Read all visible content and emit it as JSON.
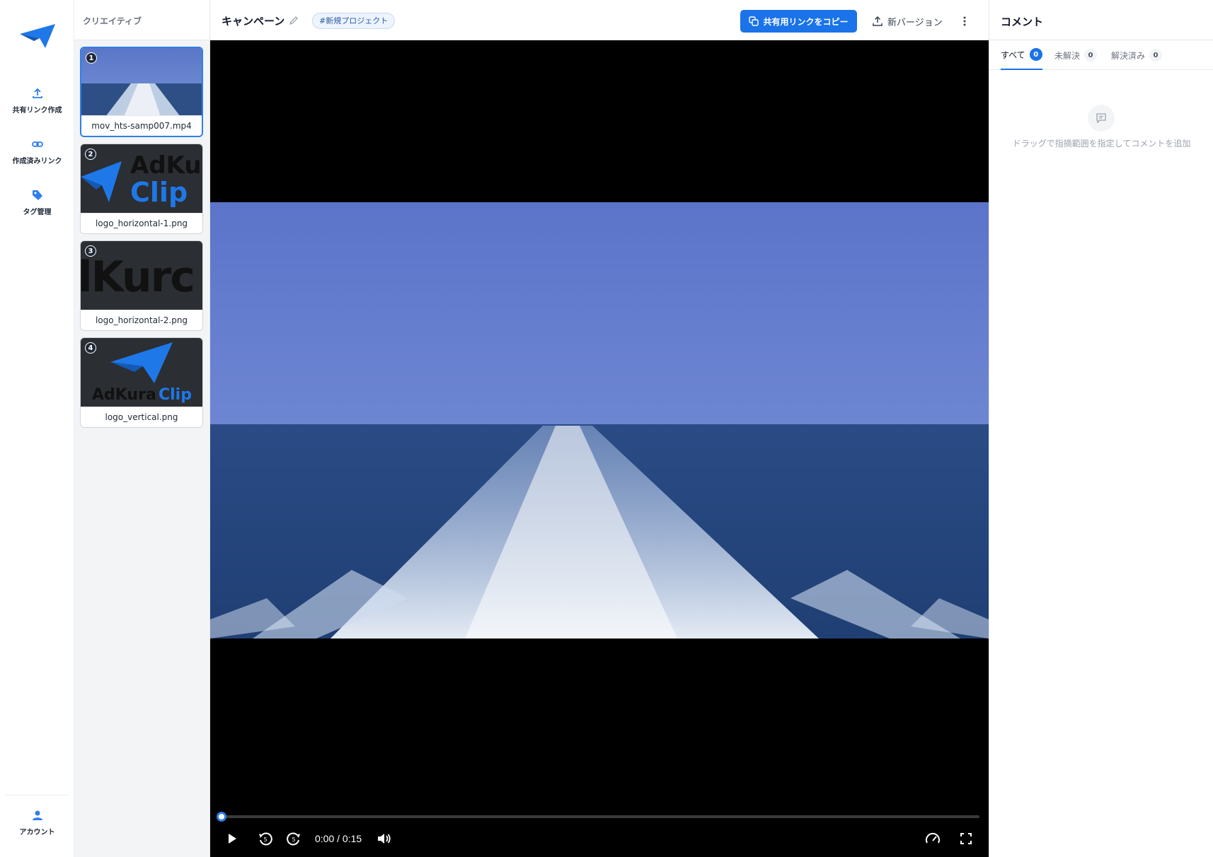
{
  "nav": {
    "items": [
      {
        "label": "共有リンク作成",
        "icon": "upload-icon"
      },
      {
        "label": "作成済みリンク",
        "icon": "link-icon"
      },
      {
        "label": "タグ管理",
        "icon": "tag-icon"
      }
    ],
    "account_label": "アカウント"
  },
  "creatives": {
    "header": "クリエイティブ",
    "items": [
      {
        "num": "1",
        "name": "mov_hts-samp007.mp4"
      },
      {
        "num": "2",
        "name": "logo_horizontal-1.png",
        "thumb_text_top": "AdKur",
        "thumb_text_bottom": "Clip"
      },
      {
        "num": "3",
        "name": "logo_horizontal-2.png",
        "thumb_text": "lKurc"
      },
      {
        "num": "4",
        "name": "logo_vertical.png",
        "thumb_text_a": "AdKura",
        "thumb_text_b": "Clip"
      }
    ]
  },
  "header": {
    "title": "キャンペーン",
    "tag": "#新規プロジェクト",
    "copy_button": "共有用リンクをコピー",
    "version_button": "新バージョン"
  },
  "player": {
    "time": "0:00 / 0:15",
    "progress": 0
  },
  "comments": {
    "title": "コメント",
    "tabs": [
      {
        "label": "すべて",
        "count": "0"
      },
      {
        "label": "未解決",
        "count": "0"
      },
      {
        "label": "解決済み",
        "count": "0"
      }
    ],
    "empty_text": "ドラッグで指摘範囲を指定してコメントを追加"
  },
  "colors": {
    "accent": "#1a73e8",
    "brand": "#1e78e8"
  }
}
